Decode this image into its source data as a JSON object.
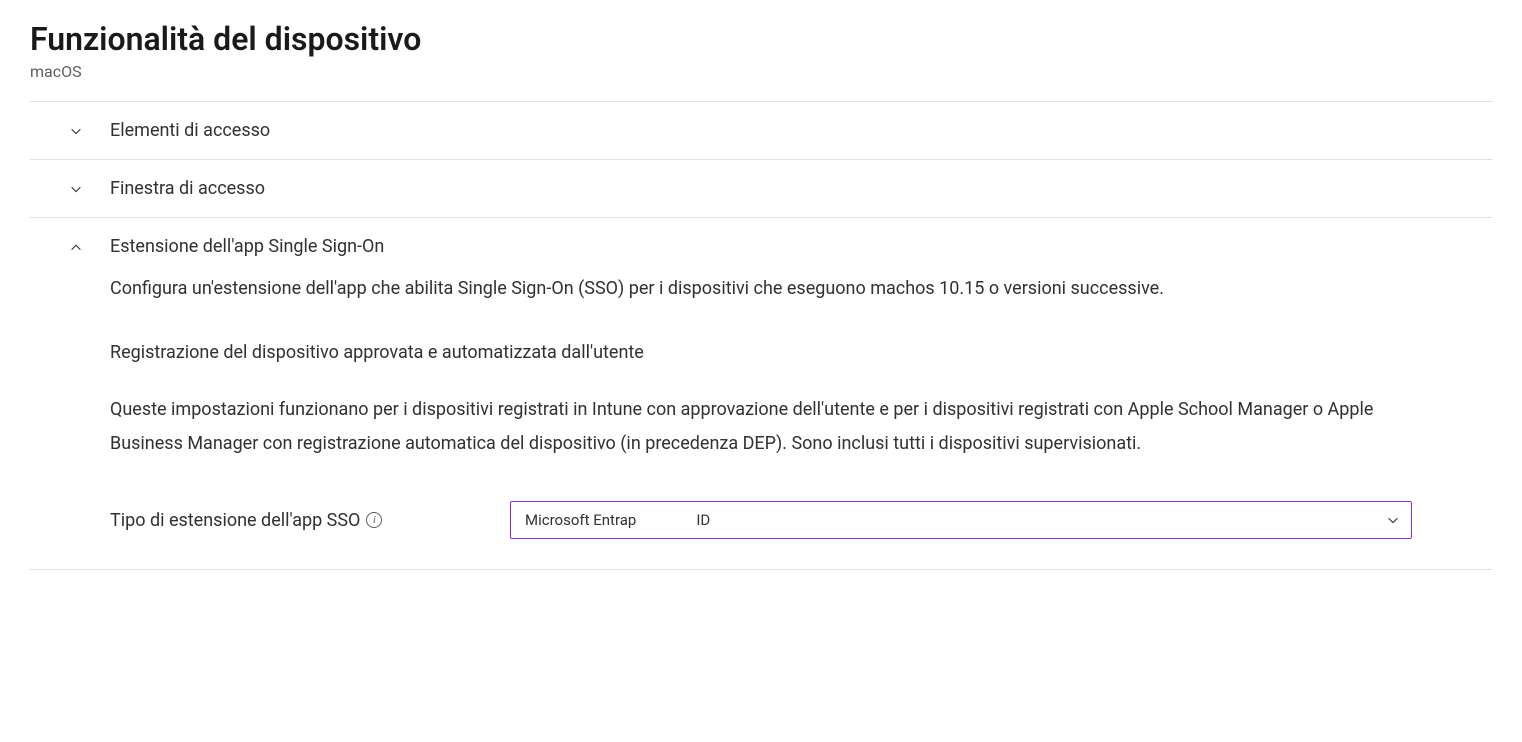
{
  "header": {
    "title": "Funzionalità del dispositivo",
    "subtitle": "macOS"
  },
  "sections": {
    "login_items": {
      "title": "Elementi di accesso"
    },
    "login_window": {
      "title": "Finestra di accesso"
    },
    "sso": {
      "title": "Estensione dell'app Single Sign-On",
      "description": "Configura un'estensione dell'app che abilita Single Sign-On (SSO) per i dispositivi che eseguono machos 10.15 o versioni successive.",
      "subsection_header": "Registrazione del dispositivo approvata e automatizzata dall'utente",
      "subsection_text": "Queste impostazioni funzionano per i dispositivi registrati in    Intune con approvazione dell'utente e per i dispositivi registrati con Apple School Manager o Apple Business Manager con registrazione automatica del dispositivo (in precedenza DEP). Sono inclusi tutti i dispositivi supervisionati.",
      "form": {
        "sso_type_label": "Tipo di estensione dell'app SSO",
        "sso_type_value_part1": "Microsoft Entrap",
        "sso_type_value_part2": "ID"
      }
    }
  }
}
